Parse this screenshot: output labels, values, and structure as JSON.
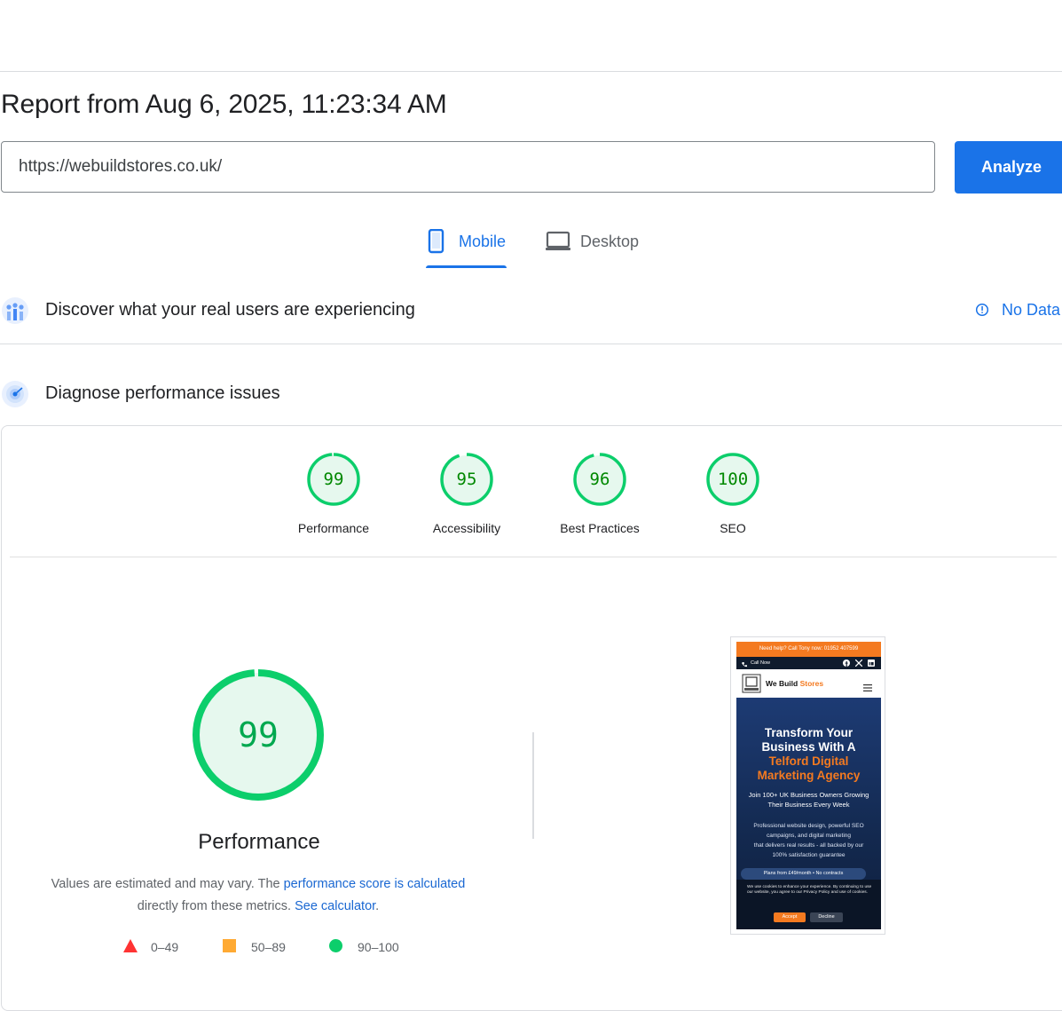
{
  "report": {
    "title": "Report from Aug 6, 2025, 11:23:34 AM"
  },
  "url_bar": {
    "value": "https://webuildstores.co.uk/",
    "analyze_label": "Analyze"
  },
  "tabs": [
    {
      "label": "Mobile",
      "icon": "smartphone-icon",
      "active": true
    },
    {
      "label": "Desktop",
      "icon": "laptop-icon",
      "active": false
    }
  ],
  "field_data": {
    "title": "Discover what your real users are experiencing",
    "status": "No Data",
    "icon": "users-chart-icon"
  },
  "diagnose": {
    "title": "Diagnose performance issues",
    "icon": "radar-icon"
  },
  "categories": [
    {
      "score": "99",
      "label": "Performance",
      "fraction": 0.99
    },
    {
      "score": "95",
      "label": "Accessibility",
      "fraction": 0.95
    },
    {
      "score": "96",
      "label": "Best Practices",
      "fraction": 0.96
    },
    {
      "score": "100",
      "label": "SEO",
      "fraction": 1.0
    }
  ],
  "performance": {
    "score": "99",
    "label": "Performance",
    "desc_prefix": "Values are estimated and may vary. The ",
    "desc_link": "performance score is calculated",
    "desc_middle": "directly from these metrics.",
    "desc_link2": "See calculator",
    "desc_suffix": "."
  },
  "legend": [
    {
      "range": "0–49",
      "color": "#ff3333",
      "shape": "triangle"
    },
    {
      "range": "50–89",
      "color": "#ffaa33",
      "shape": "square"
    },
    {
      "range": "90–100",
      "color": "#0cce6b",
      "shape": "circle"
    }
  ],
  "colors": {
    "accent": "#1a73e8",
    "pass": "#0cce6b",
    "pass_text": "#008800"
  },
  "screenshot": {
    "topbar": "Need help? Call Tony now: 01952 407599",
    "call_now": "Call Now",
    "brand_a": "We Build",
    "brand_b": "Stores",
    "hero_l1": "Transform Your",
    "hero_l2": "Business With A",
    "hero_l3": "Telford Digital",
    "hero_l4": "Marketing Agency",
    "sub_1": "Join 100+ UK Business Owners Growing",
    "sub_2": "Their Business Every Week",
    "body_1": "Professional website design, powerful SEO",
    "body_2": "campaigns, and digital marketing",
    "body_3": "that delivers real results - all backed by our",
    "body_4": "100% satisfaction guarantee",
    "pill": "Plans from £49/month • No contracts",
    "cookie_text": "We use cookies to enhance your experience. By continuing to use our website, you agree to our Privacy Policy and use of cookies.",
    "accept": "Accept",
    "decline": "Decline"
  }
}
